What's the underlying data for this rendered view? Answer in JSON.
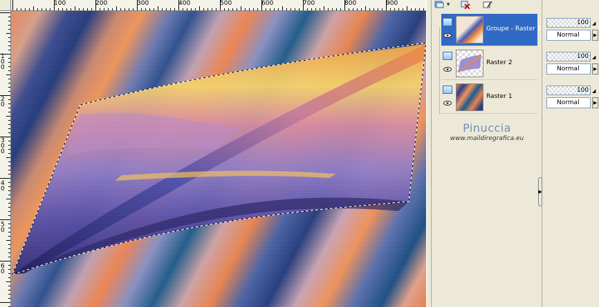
{
  "ruler": {
    "top_labels": [
      "100",
      "200",
      "300",
      "400",
      "500",
      "600",
      "700",
      "800",
      "900"
    ],
    "left_labels": [
      "1\n0\n0",
      "2\n0",
      "3\n0\n0",
      "4\n0",
      "5\n0",
      "6\n0"
    ]
  },
  "layers": {
    "items": [
      {
        "name": "Groupe - Raster 2",
        "selected": true,
        "opacity": "100",
        "blend": "Normal"
      },
      {
        "name": "Raster 2",
        "selected": false,
        "opacity": "100",
        "blend": "Normal"
      },
      {
        "name": "Raster 1",
        "selected": false,
        "opacity": "100",
        "blend": "Normal"
      }
    ]
  },
  "watermark": {
    "title": "Pinuccia",
    "subtitle": "www.maildiregrafica.eu"
  },
  "icons": {
    "layer": "layer-icon",
    "visibility": "eye-icon",
    "delete": "delete-layer-icon",
    "new_layer": "new-layer-icon"
  },
  "colors": {
    "selection": "#316ac5",
    "panel": "#ece9d8"
  }
}
